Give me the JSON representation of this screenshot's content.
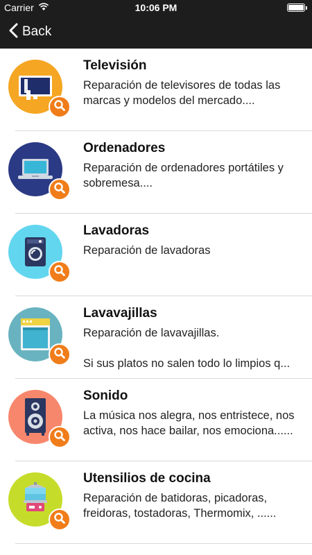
{
  "status": {
    "carrier": "Carrier",
    "time": "10:06 PM"
  },
  "nav": {
    "back_label": "Back"
  },
  "items": [
    {
      "title": "Televisión",
      "desc": "Reparación de televisores de todas las marcas y modelos del mercado....",
      "color": "#f5a623",
      "icon": "tv-icon"
    },
    {
      "title": "Ordenadores",
      "desc": "Reparación de ordenadores portátiles y sobremesa....",
      "color": "#2b3a84",
      "icon": "laptop-icon"
    },
    {
      "title": "Lavadoras",
      "desc": "Reparación de lavadoras",
      "color": "#62d6ef",
      "icon": "washing-machine-icon"
    },
    {
      "title": "Lavavajillas",
      "desc": "Reparación de lavavajillas.\n\nSi sus platos no salen todo lo limpios q...",
      "color": "#69b3c0",
      "icon": "dishwasher-icon"
    },
    {
      "title": "Sonido",
      "desc": "La música nos alegra, nos entristece, nos activa, nos hace bailar, nos emociona......",
      "color": "#f7876c",
      "icon": "speaker-icon"
    },
    {
      "title": "Utensilios de cocina",
      "desc": "Reparación de batidoras, picadoras, freidoras, tostadoras, Thermomix, ......",
      "color": "#c6dc2a",
      "icon": "steamer-icon"
    }
  ]
}
